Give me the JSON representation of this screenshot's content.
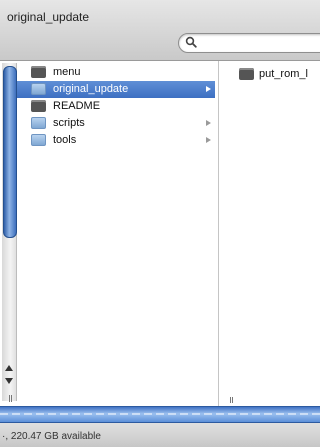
{
  "window": {
    "title": "original_update"
  },
  "search": {
    "placeholder": "",
    "icon": "magnifier-icon"
  },
  "columns": [
    {
      "items": [
        {
          "label": "menu",
          "kind": "document",
          "selected": false,
          "has_children": false
        },
        {
          "label": "original_update",
          "kind": "folder",
          "selected": true,
          "has_children": true
        },
        {
          "label": "README",
          "kind": "document",
          "selected": false,
          "has_children": false
        },
        {
          "label": "scripts",
          "kind": "folder",
          "selected": false,
          "has_children": true
        },
        {
          "label": "tools",
          "kind": "folder",
          "selected": false,
          "has_children": true
        }
      ]
    },
    {
      "items": [
        {
          "label": "put_rom_l",
          "kind": "document",
          "selected": false,
          "has_children": false
        }
      ]
    }
  ],
  "status": {
    "text": "·, 220.47 GB available"
  },
  "colors": {
    "selection": "#3d6fc2",
    "scroll_thumb": "#4f82d0"
  }
}
